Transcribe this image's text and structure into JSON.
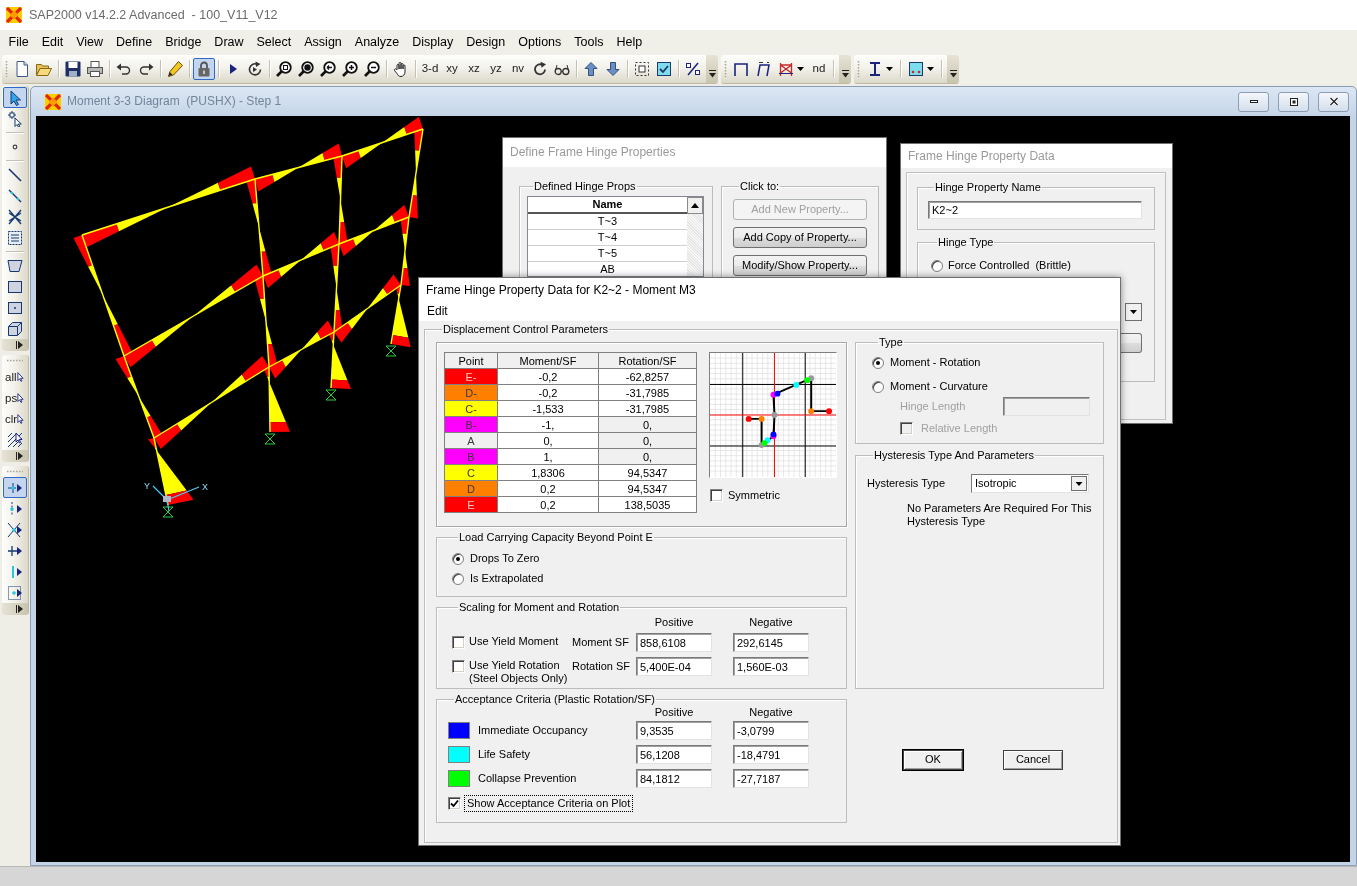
{
  "app": {
    "title": "SAP2000 v14.2.2 Advanced  - 100_V11_V12"
  },
  "menu": [
    "File",
    "Edit",
    "View",
    "Define",
    "Bridge",
    "Draw",
    "Select",
    "Assign",
    "Analyze",
    "Display",
    "Design",
    "Options",
    "Tools",
    "Help"
  ],
  "toolbars": [
    {
      "items": [
        {
          "kind": "icon",
          "pressed": false
        },
        {
          "kind": "icon",
          "pressed": false
        },
        {
          "kind": "separator"
        },
        {
          "kind": "icon",
          "pressed": false
        },
        {
          "kind": "icon",
          "pressed": false
        },
        {
          "kind": "separator"
        },
        {
          "kind": "icon",
          "pressed": false
        },
        {
          "kind": "icon",
          "pressed": false
        },
        {
          "kind": "separator"
        },
        {
          "kind": "icon",
          "pressed": false
        },
        {
          "kind": "separator"
        },
        {
          "kind": "icon",
          "pressed": true
        },
        {
          "kind": "separator"
        },
        {
          "kind": "icon",
          "pressed": false
        },
        {
          "kind": "icon",
          "pressed": false
        },
        {
          "kind": "separator"
        },
        {
          "kind": "icon",
          "pressed": false
        },
        {
          "kind": "icon",
          "pressed": false
        },
        {
          "kind": "icon",
          "pressed": false
        },
        {
          "kind": "icon",
          "pressed": false
        },
        {
          "kind": "icon",
          "pressed": false
        },
        {
          "kind": "separator"
        },
        {
          "kind": "icon",
          "pressed": false
        },
        {
          "kind": "separator"
        },
        {
          "kind": "text",
          "label": "3-d",
          "pressed": false
        },
        {
          "kind": "text",
          "label": "xy",
          "pressed": false
        },
        {
          "kind": "text",
          "label": "xz",
          "pressed": false
        },
        {
          "kind": "text",
          "label": "yz",
          "pressed": false
        },
        {
          "kind": "text",
          "label": "nv",
          "pressed": false
        },
        {
          "kind": "icon",
          "pressed": false
        },
        {
          "kind": "icon",
          "pressed": false
        },
        {
          "kind": "separator"
        },
        {
          "kind": "icon",
          "pressed": false
        },
        {
          "kind": "icon",
          "pressed": false
        },
        {
          "kind": "separator"
        },
        {
          "kind": "icon",
          "pressed": false
        },
        {
          "kind": "icon",
          "pressed": false
        },
        {
          "kind": "separator"
        },
        {
          "kind": "icon",
          "pressed": false
        }
      ]
    },
    {
      "items": [
        {
          "kind": "icon",
          "pressed": false
        },
        {
          "kind": "icon",
          "pressed": false
        },
        {
          "kind": "split",
          "pressed": false
        },
        {
          "kind": "text",
          "label": "nd",
          "pressed": false
        },
        {
          "kind": "separator"
        }
      ]
    },
    {
      "items": [
        {
          "kind": "split",
          "pressed": false
        },
        {
          "kind": "separator"
        },
        {
          "kind": "split",
          "pressed": false
        },
        {
          "kind": "separator"
        }
      ]
    }
  ],
  "side_toolbars": [
    {
      "items": [
        {
          "kind": "icon",
          "pressed": true
        },
        {
          "kind": "icon",
          "pressed": false
        },
        {
          "kind": "separator"
        },
        {
          "kind": "icon",
          "pressed": false
        },
        {
          "kind": "separator"
        },
        {
          "kind": "icon",
          "pressed": false
        },
        {
          "kind": "icon",
          "pressed": false
        },
        {
          "kind": "icon",
          "pressed": false
        },
        {
          "kind": "icon",
          "pressed": false
        },
        {
          "kind": "separator"
        },
        {
          "kind": "icon",
          "pressed": false
        },
        {
          "kind": "icon",
          "pressed": false
        },
        {
          "kind": "icon",
          "pressed": false
        },
        {
          "kind": "icon",
          "pressed": false
        }
      ]
    },
    {
      "items": [
        {
          "kind": "text",
          "label": "all",
          "pressed": false
        },
        {
          "kind": "text",
          "label": "ps",
          "pressed": false
        },
        {
          "kind": "text",
          "label": "clr",
          "pressed": false
        },
        {
          "kind": "icon",
          "pressed": false
        }
      ]
    },
    {
      "items": [
        {
          "kind": "icon",
          "pressed": true
        },
        {
          "kind": "icon",
          "pressed": false
        },
        {
          "kind": "icon",
          "pressed": false
        },
        {
          "kind": "icon",
          "pressed": false
        },
        {
          "kind": "icon",
          "pressed": false
        },
        {
          "kind": "icon",
          "pressed": false
        }
      ]
    }
  ],
  "document_window": {
    "title": "Moment 3-3 Diagram  (PUSHX) - Step 1",
    "axis_labels": [
      "Y",
      "X"
    ]
  },
  "define_dialog": {
    "title": "Define Frame Hinge Properties",
    "list_group": "Defined Hinge Props",
    "list_header": "Name",
    "items": [
      {
        "label": "T~3",
        "selected": false
      },
      {
        "label": "T~4",
        "selected": false
      },
      {
        "label": "T~5",
        "selected": false
      },
      {
        "label": "AB",
        "selected": false
      }
    ],
    "actions_group": "Click to:",
    "buttons": [
      {
        "label": "Add New Property...",
        "disabled": true
      },
      {
        "label": "Add Copy of Property...",
        "disabled": false
      },
      {
        "label": "Modify/Show Property...",
        "disabled": false
      }
    ]
  },
  "property_dialog": {
    "title": "Frame Hinge Property Data",
    "name_group": "Hinge Property Name",
    "name_value": "K2~2",
    "type_group": "Hinge Type",
    "type_options": [
      {
        "label": "Force Controlled  (Brittle)",
        "selected": false
      }
    ]
  },
  "hinge_dialog": {
    "title": "Frame Hinge Property Data for K2~2 - Moment M3",
    "menu": [
      "Edit"
    ],
    "displacement": {
      "group": "Displacement Control Parameters",
      "columns": [
        "Point",
        "Moment/SF",
        "Rotation/SF"
      ],
      "rows": [
        {
          "point": "E-",
          "color": "#ff0000",
          "moment": "-0,2",
          "rotation": "-62,8257",
          "rotation_locked": false
        },
        {
          "point": "D-",
          "color": "#ff8000",
          "moment": "-0,2",
          "rotation": "-31,7985",
          "rotation_locked": false
        },
        {
          "point": "C-",
          "color": "#ffff00",
          "moment": "-1,533",
          "rotation": "-31,7985",
          "rotation_locked": false
        },
        {
          "point": "B-",
          "color": "#ff00ff",
          "moment": "-1,",
          "rotation": "0,",
          "rotation_locked": true
        },
        {
          "point": "A",
          "color": "#f0f0f0",
          "moment": "0,",
          "rotation": "0,",
          "rotation_locked": true
        },
        {
          "point": "B",
          "color": "#ff00ff",
          "moment": "1,",
          "rotation": "0,",
          "rotation_locked": true
        },
        {
          "point": "C",
          "color": "#ffff00",
          "moment": "1,8306",
          "rotation": "94,5347",
          "rotation_locked": false
        },
        {
          "point": "D",
          "color": "#ff8000",
          "moment": "0,2",
          "rotation": "94,5347",
          "rotation_locked": false
        },
        {
          "point": "E",
          "color": "#ff0000",
          "moment": "0,2",
          "rotation": "138,5035",
          "rotation_locked": false
        }
      ],
      "symmetric": {
        "label": "Symmetric",
        "checked": false
      }
    },
    "capacity": {
      "group": "Load Carrying Capacity Beyond Point E",
      "options": [
        {
          "label": "Drops To Zero",
          "selected": true
        },
        {
          "label": "Is Extrapolated",
          "selected": false
        }
      ]
    },
    "scaling": {
      "group": "Scaling for Moment and Rotation",
      "columns": [
        "Positive",
        "Negative"
      ],
      "rows": [
        {
          "option": "Use Yield Moment",
          "checked": false,
          "label": "Moment SF",
          "positive": "858,6108",
          "negative": "292,6145"
        },
        {
          "option": "Use Yield Rotation",
          "note": "(Steel Objects Only)",
          "checked": false,
          "label": "Rotation SF",
          "positive": "5,400E-04",
          "negative": "1,560E-03"
        }
      ]
    },
    "acceptance": {
      "group": "Acceptance Criteria (Plastic Rotation/SF)",
      "columns": [
        "Positive",
        "Negative"
      ],
      "rows": [
        {
          "label": "Immediate Occupancy",
          "color": "#0000ff",
          "positive": "9,3535",
          "negative": "-3,0799"
        },
        {
          "label": "Life Safety",
          "color": "#00ffff",
          "positive": "56,1208",
          "negative": "-18,4791"
        },
        {
          "label": "Collapse Prevention",
          "color": "#00ff00",
          "positive": "84,1812",
          "negative": "-27,7187"
        }
      ],
      "show_on_plot": {
        "label": "Show Acceptance Criteria on Plot",
        "checked": true,
        "focused": true
      }
    },
    "type": {
      "group": "Type",
      "options": [
        {
          "label": "Moment - Rotation",
          "selected": true
        },
        {
          "label": "Moment - Curvature",
          "selected": false
        }
      ],
      "hinge_length": {
        "label": "Hinge Length",
        "disabled": true
      },
      "relative_length": {
        "label": "Relative Length",
        "checked": false,
        "disabled": true
      }
    },
    "hysteresis": {
      "group": "Hysteresis Type And Parameters",
      "label": "Hysteresis Type",
      "value": "Isotropic",
      "note": "No Parameters Are Required For This Hysteresis Type"
    },
    "buttons": [
      {
        "label": "OK",
        "default": true
      },
      {
        "label": "Cancel",
        "default": false
      }
    ]
  }
}
